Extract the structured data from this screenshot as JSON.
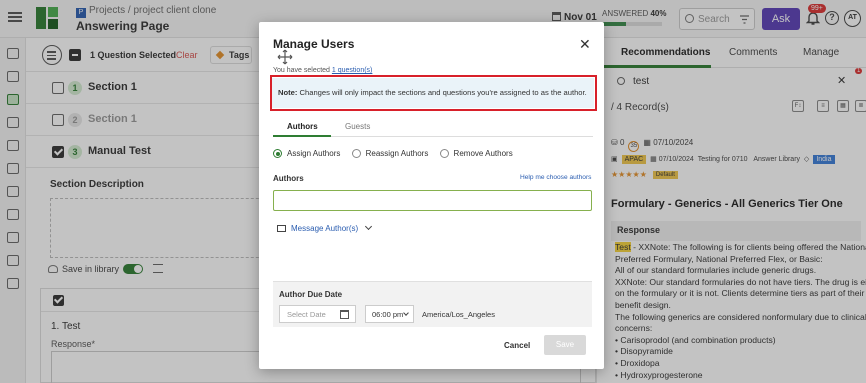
{
  "topbar": {
    "breadcrumb": "Projects / project client clone",
    "breadcrumb_icon": "P",
    "page_title": "Answering Page",
    "date": "Nov 01",
    "answered_label": "ANSWERED",
    "answered_percent": "40%",
    "answered_fraction": 0.4,
    "search_placeholder": "Search",
    "ask_label": "Ask",
    "notifications_badge": "99+",
    "help_label": "?",
    "avatar_initials": "AT",
    "brand_color": "#2e7d32",
    "ask_color": "#5a3fb8"
  },
  "toolbar": {
    "selected_label": "1 Question Selected",
    "clear_label": "Clear",
    "tags_label": "Tags"
  },
  "sections": [
    {
      "number": "1",
      "title": "Section 1"
    },
    {
      "number": "2",
      "title": "Section 1"
    },
    {
      "number": "3",
      "title": "Manual Test"
    }
  ],
  "section_detail": {
    "description_label": "Section Description",
    "save_in_library_label": "Save in library",
    "save_in_library_on": true
  },
  "question": {
    "title": "1. Test",
    "response_label": "Response*"
  },
  "right_panel": {
    "tabs": [
      "Recommendations",
      "Comments",
      "Manage"
    ],
    "search_text": "test",
    "filter_badge": "1",
    "records": "/ 4 Record(s)",
    "record": {
      "count_a": "0",
      "score": "35",
      "date_a": "07/10/2024",
      "region": "APAC",
      "date_b": "07/10/2024",
      "testing": "Testing for 0710",
      "source": "Answer Library",
      "tag": "India",
      "stars": "★★★★★",
      "default_label": "Default"
    },
    "heading": "Formulary - Generics - All Generics Tier One",
    "response_label": "Response",
    "response_highlight": "Test",
    "response_lines": [
      " - XXNote: The following is for clients being offered the National",
      "Preferred Formulary, National Preferred Flex, or Basic:",
      "All of our standard formularies include generic drugs.",
      "XXNote: Our standard formularies do not have tiers. The drug is either",
      "on the formulary or it is not. Clients determine tiers as part of their",
      "benefit design.",
      "The following generics are considered nonformulary due to clinical",
      "concerns:",
      "• Carisoprodol (and combination products)",
      "• Disopyramide",
      "• Droxidopa",
      "• Hydroxyprogesterone"
    ]
  },
  "modal": {
    "title": "Manage Users",
    "close_label": "✕",
    "selected_prefix": "You have selected ",
    "selected_link": "1 question(s)",
    "note_label": "Note:",
    "note_text": " Changes will only impact the sections and questions you're assigned to as the author.",
    "tabs": [
      "Authors",
      "Guests"
    ],
    "radios": [
      "Assign Authors",
      "Reassign Authors",
      "Remove Authors"
    ],
    "selected_radio": 0,
    "authors_label": "Authors",
    "help_link": "Help me choose authors",
    "authors_value": "",
    "message_label": "Message Author(s)",
    "due_date_label": "Author Due Date",
    "date_placeholder": "Select Date",
    "time_value": "06:00 pm",
    "timezone": "America/Los_Angeles",
    "cancel_label": "Cancel",
    "save_label": "Save",
    "highlight_color": "#d8202a"
  }
}
